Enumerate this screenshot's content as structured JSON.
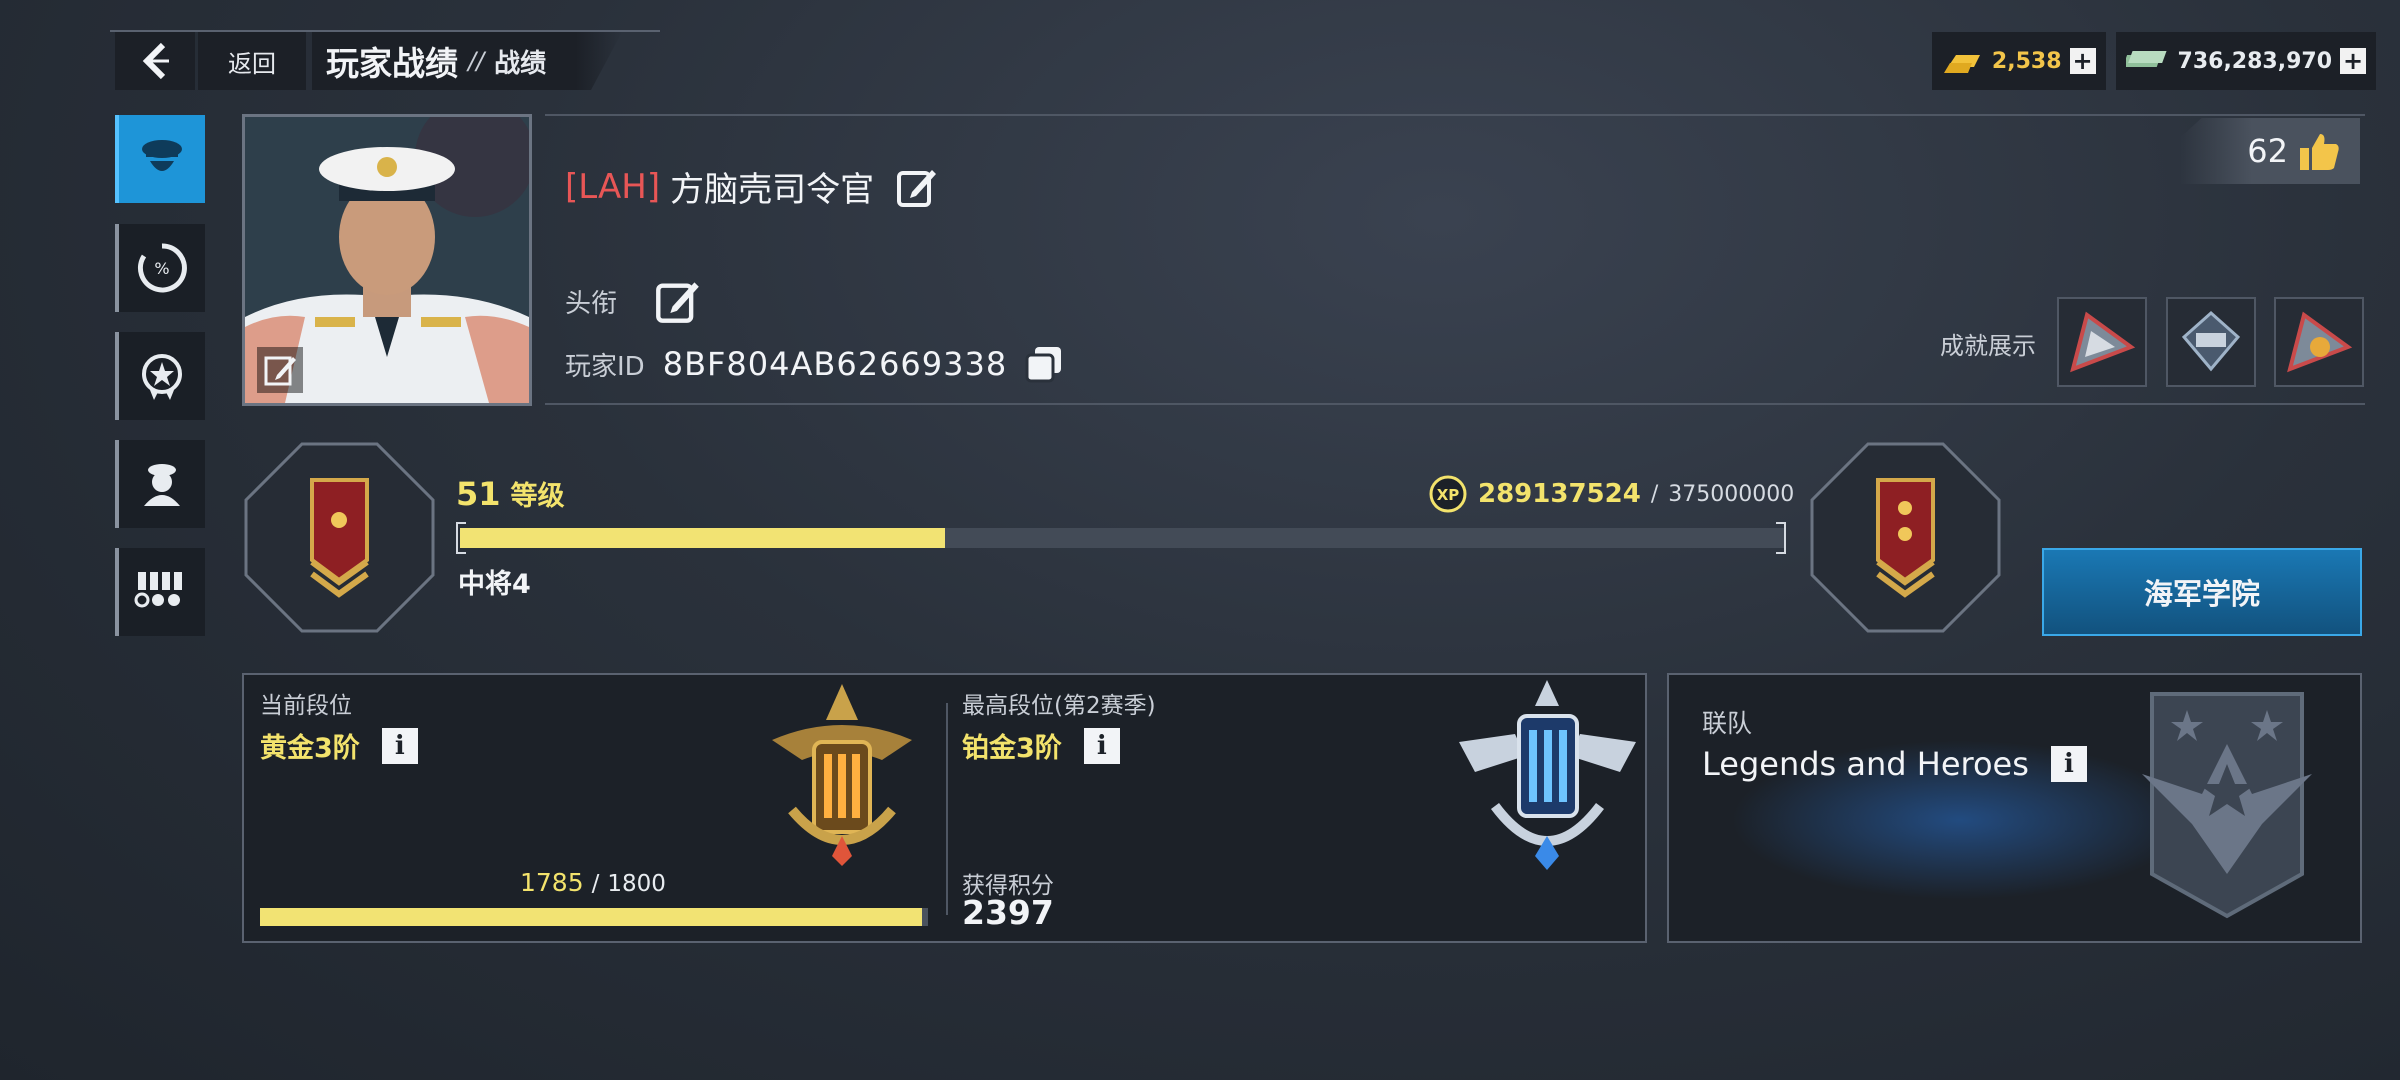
{
  "header": {
    "back_label": "返回",
    "title": "玩家战绩",
    "separator": "//",
    "subtitle": "战绩"
  },
  "currency": {
    "gold": "2,538",
    "cash": "736,283,970",
    "gold_color": "#f3c54a"
  },
  "sidebar": {
    "items": [
      {
        "name": "officer",
        "icon": "officer-cap-icon",
        "active": true
      },
      {
        "name": "stats",
        "icon": "percent-gauge-icon",
        "active": false
      },
      {
        "name": "achievements",
        "icon": "star-badge-icon",
        "active": false
      },
      {
        "name": "crew",
        "icon": "crew-icon",
        "active": false
      },
      {
        "name": "medals",
        "icon": "medal-rack-icon",
        "active": false
      }
    ]
  },
  "profile": {
    "clan_tag": "[LAH]",
    "player_name": "方脑壳司令官",
    "title_label": "头衔",
    "id_label": "玩家ID",
    "player_id": "8BF804AB62669338",
    "likes": "62",
    "achievements_label": "成就展示"
  },
  "level": {
    "level_number": "51",
    "level_word": "等级",
    "xp_current": "289137524",
    "xp_separator": "/",
    "xp_max": "375000000",
    "rank_name": "中将4",
    "progress_fraction": 0.366
  },
  "academy_button": "海军学院",
  "ranked": {
    "current_label": "当前段位",
    "current_tier": "黄金3阶",
    "points_current": "1785",
    "points_separator": "/",
    "points_max": "1800",
    "points_fraction": 0.9917,
    "highest_label": "最高段位(第2赛季)",
    "highest_tier": "铂金3阶",
    "score_label": "获得积分",
    "score_value": "2397"
  },
  "fleet": {
    "label": "联队",
    "name": "Legends and Heroes"
  },
  "colors": {
    "accent_blue": "#1e95d8",
    "yellow": "#f3e36c",
    "clan_red": "#e85656"
  }
}
